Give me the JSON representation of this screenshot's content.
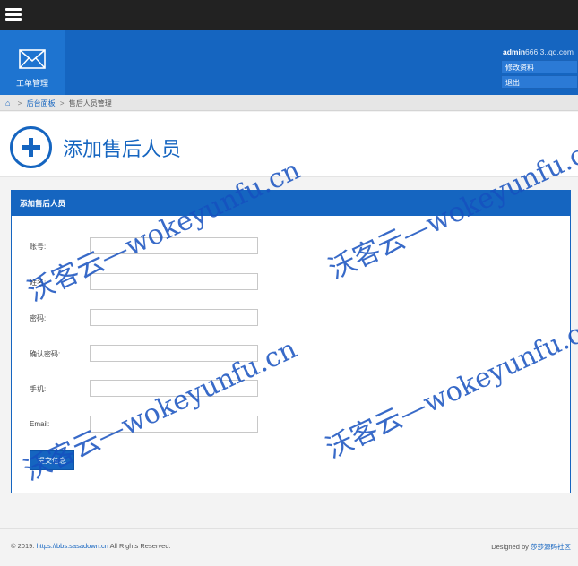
{
  "header": {
    "tile_label": "工单管理",
    "user_name": "admin",
    "user_email": "666.3..qq.com",
    "change_password": "修改资料",
    "logout": "退出"
  },
  "breadcrumb": {
    "home_icon": "home-icon",
    "items": [
      "后台面板",
      "售后人员管理"
    ]
  },
  "page": {
    "title": "添加售后人员"
  },
  "form": {
    "panel_title": "添加售后人员",
    "fields": [
      {
        "label": "账号:",
        "value": ""
      },
      {
        "label": "姓名:",
        "value": ""
      },
      {
        "label": "密码:",
        "value": ""
      },
      {
        "label": "确认密码:",
        "value": ""
      },
      {
        "label": "手机:",
        "value": ""
      },
      {
        "label": "Email:",
        "value": ""
      }
    ],
    "submit_label": "提交信息"
  },
  "footer": {
    "copyright_prefix": "© 2019.",
    "copyright_link": "https://bbs.sasadown.cn",
    "copyright_suffix": "All Rights Reserved.",
    "designed_prefix": "Designed by",
    "designed_link": "莎莎源码社区"
  },
  "watermark": {
    "text": "沃客云—wokeyunfu.cn"
  },
  "colors": {
    "brand_blue": "#1565c0",
    "topbar": "#222222"
  }
}
